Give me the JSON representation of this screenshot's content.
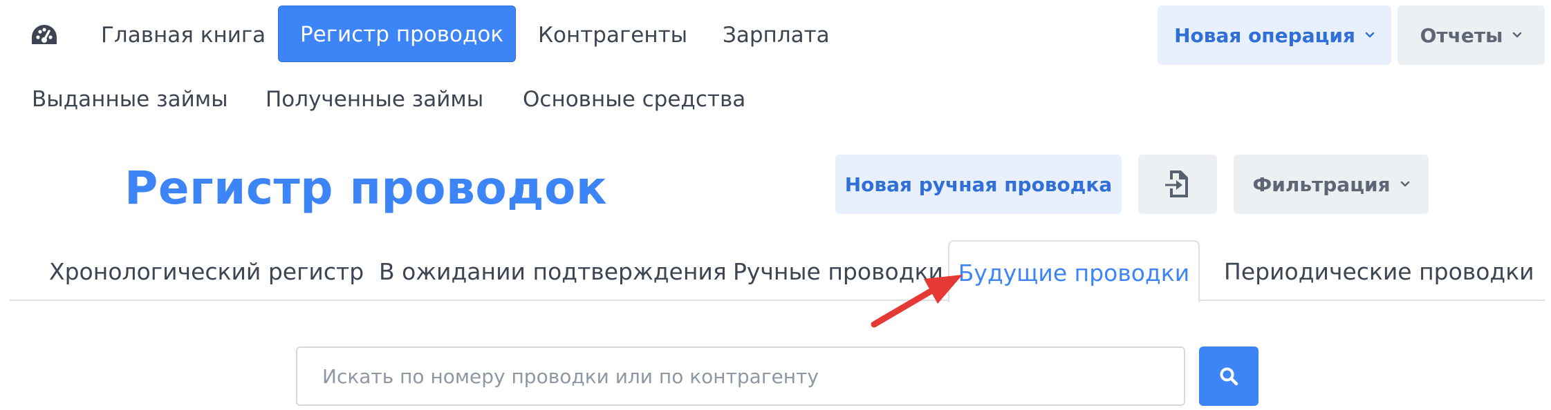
{
  "nav": {
    "primary": [
      {
        "label": "Главная книга"
      },
      {
        "label": "Регистр проводок"
      },
      {
        "label": "Контрагенты"
      },
      {
        "label": "Зарплата"
      }
    ],
    "secondary": [
      {
        "label": "Выданные займы"
      },
      {
        "label": "Полученные займы"
      },
      {
        "label": "Основные средства"
      }
    ],
    "new_operation_label": "Новая операция",
    "reports_label": "Отчеты"
  },
  "page": {
    "title": "Регистр проводок",
    "new_manual_entry_label": "Новая ручная проводка",
    "filter_label": "Фильтрация"
  },
  "tabs": [
    {
      "label": "Хронологический регистр"
    },
    {
      "label": "В ожидании подтверждения"
    },
    {
      "label": "Ручные проводки"
    },
    {
      "label": "Будущие проводки"
    },
    {
      "label": "Периодические проводки"
    }
  ],
  "search": {
    "placeholder": "Искать по номеру проводки или по контрагенту",
    "value": ""
  },
  "colors": {
    "accent": "#3d85f7",
    "accent_light": "#e8f0fd",
    "neutral_button": "#edf0f3",
    "annotation_arrow": "#e53935"
  },
  "icons": {
    "dashboard": "dashboard-gauge-icon",
    "import": "file-import-icon",
    "search": "search-icon",
    "chevron": "chevron-down-icon"
  }
}
